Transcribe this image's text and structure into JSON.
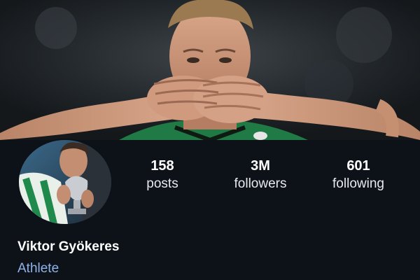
{
  "profile": {
    "name": "Viktor Gyökeres",
    "category": "Athlete",
    "cover_image": "cover-photo",
    "avatar_image": "profile-avatar"
  },
  "stats": {
    "posts": {
      "value": "158",
      "label": "posts"
    },
    "followers": {
      "value": "3M",
      "label": "followers"
    },
    "following": {
      "value": "601",
      "label": "following"
    }
  },
  "colors": {
    "background": "#0d1118",
    "category_text": "#8fb3e8",
    "jersey_green": "#1f7a45"
  }
}
